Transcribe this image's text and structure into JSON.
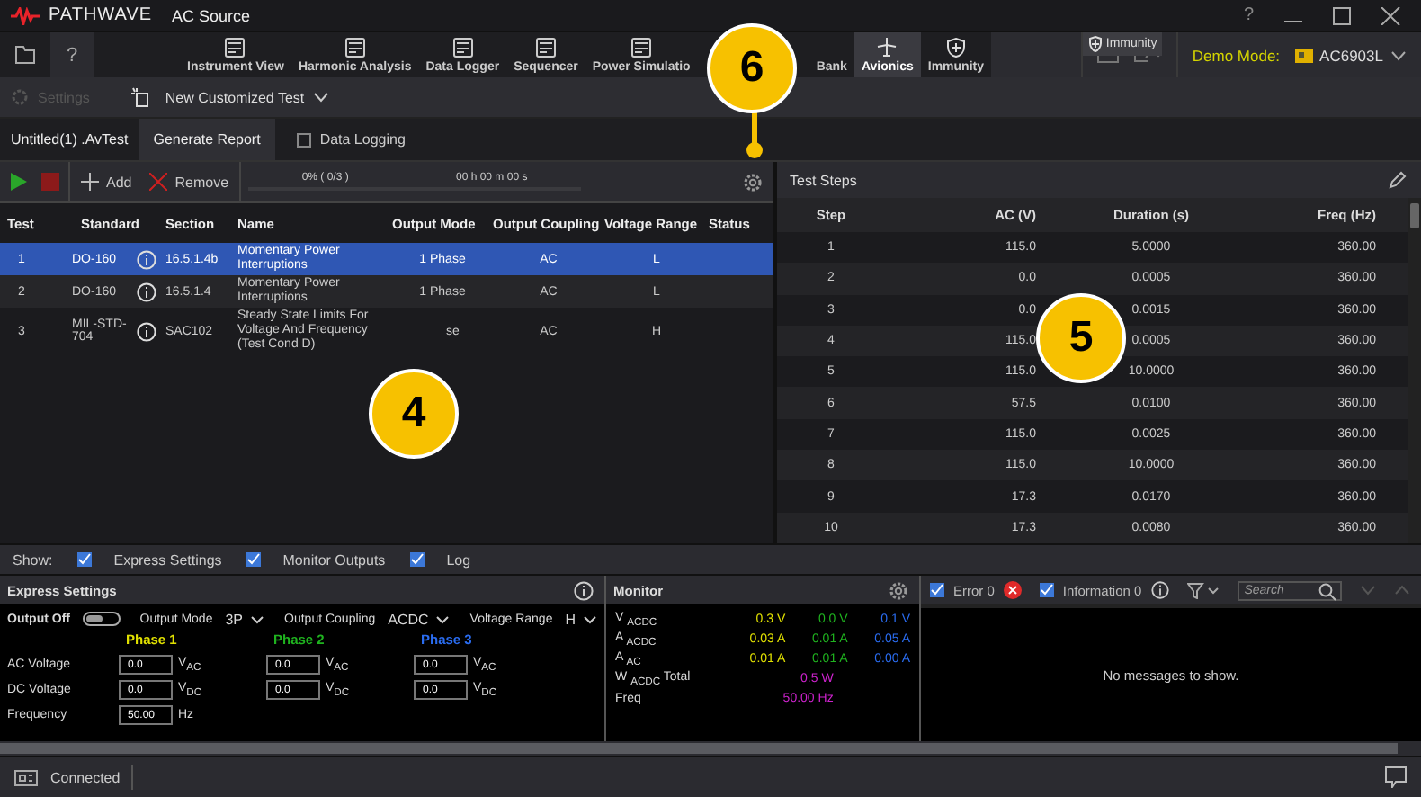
{
  "app": {
    "brand": "PATHWAVE",
    "title": "AC Source",
    "help": "?"
  },
  "nav": {
    "help": "?",
    "tabs": [
      {
        "label": "Instrument View",
        "selected": false
      },
      {
        "label": "Harmonic Analysis",
        "selected": false
      },
      {
        "label": "Data Logger",
        "selected": false
      },
      {
        "label": "Sequencer",
        "selected": false
      },
      {
        "label": "Power Simulatio",
        "selected": false
      },
      {
        "label": "Bank",
        "selected": false
      },
      {
        "label": "Avionics",
        "selected": true
      },
      {
        "label": "Immunity",
        "selected": false
      }
    ],
    "tooltip": "Immunity",
    "demo_label": "Demo Mode:",
    "model": "AC6903L"
  },
  "toolbar": {
    "settings": "Settings",
    "test_menu": "New Customized Test"
  },
  "document": {
    "file": "Untitled(1) .AvTest",
    "report": "Generate Report",
    "data_logging": {
      "label": "Data Logging",
      "checked": false
    }
  },
  "run_bar": {
    "add": "Add",
    "remove": "Remove",
    "progress": "0% ( 0/3 )",
    "elapsed": "00 h 00 m 00 s",
    "level": 0
  },
  "tests": {
    "columns": [
      "Test",
      "Standard",
      "Section",
      "Name",
      "Output Mode",
      "Output Coupling",
      "Voltage Range",
      "Status"
    ],
    "rows": [
      {
        "test": "1",
        "standard": "DO-160",
        "section": "16.5.1.4b",
        "name": "Momentary Power Interruptions",
        "output_mode": "1 Phase",
        "output_coupling": "AC",
        "voltage_range": "L",
        "selected": true
      },
      {
        "test": "2",
        "standard": "DO-160",
        "section": "16.5.1.4",
        "name": "Momentary Power Interruptions",
        "output_mode": "1 Phase",
        "output_coupling": "AC",
        "voltage_range": "L",
        "selected": false
      },
      {
        "test": "3",
        "standard": "MIL-STD-704",
        "section": "SAC102",
        "name": "Steady State Limits For Voltage And Frequency (Test Cond D)",
        "output_mode": "se",
        "output_coupling": "AC",
        "voltage_range": "H",
        "selected": false
      }
    ]
  },
  "test_steps": {
    "title": "Test Steps",
    "columns": [
      "Step",
      "AC (V)",
      "Duration (s)",
      "Freq (Hz)"
    ],
    "rows": [
      [
        "1",
        "115.0",
        "5.0000",
        "360.00"
      ],
      [
        "2",
        "0.0",
        "0.0005",
        "360.00"
      ],
      [
        "3",
        "0.0",
        "0.0015",
        "360.00"
      ],
      [
        "4",
        "115.0",
        "0.0005",
        "360.00"
      ],
      [
        "5",
        "115.0",
        "10.0000",
        "360.00"
      ],
      [
        "6",
        "57.5",
        "0.0100",
        "360.00"
      ],
      [
        "7",
        "115.0",
        "0.0025",
        "360.00"
      ],
      [
        "8",
        "115.0",
        "10.0000",
        "360.00"
      ],
      [
        "9",
        "17.3",
        "0.0170",
        "360.00"
      ],
      [
        "10",
        "17.3",
        "0.0080",
        "360.00"
      ]
    ]
  },
  "show": {
    "label": "Show:",
    "options": [
      {
        "label": "Express Settings",
        "checked": true
      },
      {
        "label": "Monitor Outputs",
        "checked": true
      },
      {
        "label": "Log",
        "checked": true
      }
    ]
  },
  "express": {
    "title": "Express Settings",
    "output": {
      "label": "Output Off",
      "on": false
    },
    "selectors": [
      {
        "label": "Output Mode",
        "value": "3P"
      },
      {
        "label": "Output Coupling",
        "value": "ACDC"
      },
      {
        "label": "Voltage Range",
        "value": "H"
      }
    ],
    "phases": [
      {
        "name": "Phase 1",
        "color": "#e0e000"
      },
      {
        "name": "Phase 2",
        "color": "#1fb31f"
      },
      {
        "name": "Phase 3",
        "color": "#2a6cf0"
      }
    ],
    "rows": [
      {
        "label": "AC Voltage",
        "values": [
          {
            "value": "0.0",
            "unit": "V$_{AC}$"
          },
          {
            "value": "0.0",
            "unit": "V$_{AC}$"
          },
          {
            "value": "0.0",
            "unit": "V$_{AC}$"
          }
        ]
      },
      {
        "label": "DC Voltage",
        "values": [
          {
            "value": "0.0",
            "unit": "V$_{DC}$"
          },
          {
            "value": "0.0",
            "unit": "V$_{DC}$"
          },
          {
            "value": "0.0",
            "unit": "V$_{DC}$"
          }
        ]
      },
      {
        "label": "Frequency",
        "values": [
          {
            "value": "50.00",
            "unit": "Hz"
          }
        ]
      }
    ]
  },
  "monitor": {
    "title": "Monitor",
    "rows": [
      {
        "label": "V $_{ACDC}$",
        "values": [
          {
            "text": "0.3 V",
            "color": "#e0e000"
          },
          {
            "text": "0.0 V",
            "color": "#1fb31f"
          },
          {
            "text": "0.1 V",
            "color": "#2a6cf0"
          }
        ]
      },
      {
        "label": "A $_{ACDC}$",
        "values": [
          {
            "text": "0.03 A",
            "color": "#e0e000"
          },
          {
            "text": "0.01 A",
            "color": "#1fb31f"
          },
          {
            "text": "0.05 A",
            "color": "#2a6cf0"
          }
        ]
      },
      {
        "label": "A $_{AC}$",
        "values": [
          {
            "text": "0.01 A",
            "color": "#e0e000"
          },
          {
            "text": "0.01 A",
            "color": "#1fb31f"
          },
          {
            "text": "0.00 A",
            "color": "#2a6cf0"
          }
        ]
      },
      {
        "label": "W $_{ACDC}$ Total",
        "values": [
          {
            "text": "0.5 W",
            "color": "#cc22cc"
          }
        ]
      },
      {
        "label": "Freq",
        "values": [
          {
            "text": "50.00 Hz",
            "color": "#cc22cc"
          }
        ]
      }
    ]
  },
  "log": {
    "filters": [
      {
        "label": "Error 0",
        "checked": true,
        "kind": "error"
      },
      {
        "label": "Information 0",
        "checked": true,
        "kind": "info"
      }
    ],
    "search": {
      "placeholder": "Search"
    },
    "empty": "No messages to show."
  },
  "status": {
    "text": "Connected"
  },
  "callouts": [
    {
      "label": "6"
    },
    {
      "label": "4"
    },
    {
      "label": "5"
    }
  ]
}
